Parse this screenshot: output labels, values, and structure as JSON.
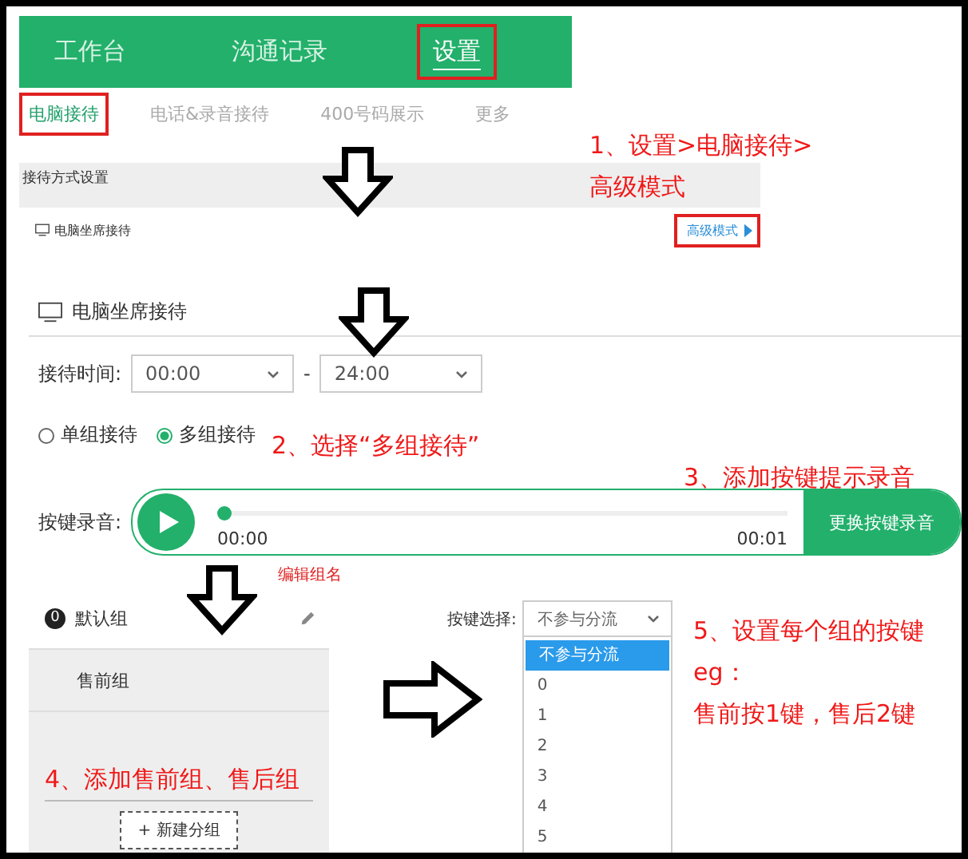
{
  "top_nav": {
    "tabs": [
      {
        "label": "工作台",
        "selected": false,
        "highlighted": false
      },
      {
        "label": "沟通记录",
        "selected": false,
        "highlighted": false
      },
      {
        "label": "设置",
        "selected": true,
        "highlighted": true
      }
    ]
  },
  "sub_tabs": [
    {
      "label": "电脑接待",
      "selected": true,
      "highlighted": true
    },
    {
      "label": "电话&录音接待",
      "selected": false,
      "highlighted": false
    },
    {
      "label": "400号码展示",
      "selected": false,
      "highlighted": false
    },
    {
      "label": "更多",
      "selected": false,
      "highlighted": false
    }
  ],
  "section": {
    "title": "接待方式设置",
    "row_label": "电脑坐席接待",
    "link": "高级模式",
    "link_highlighted": true
  },
  "panel": {
    "title": "电脑坐席接待",
    "time_label": "接待时间:",
    "start": "00:00",
    "separator": "-",
    "end": "24:00",
    "modes": [
      {
        "label": "单组接待",
        "selected": false
      },
      {
        "label": "多组接待",
        "selected": true
      }
    ],
    "recording_label": "按键录音:",
    "player": {
      "level": 0,
      "elapsed": "00:00",
      "total": "00:01",
      "button": "更换按键录音"
    }
  },
  "groups": [
    {
      "badge": "0",
      "name": "默认组",
      "selected": true
    },
    {
      "name": "售前组",
      "selected": false
    }
  ],
  "edit_hint": "编辑组名",
  "new_group_button": "+ 新建分组",
  "key_select": {
    "label": "按键选择:",
    "value": "不参与分流",
    "options": [
      {
        "label": "不参与分流",
        "selected": true
      },
      {
        "label": "0",
        "selected": false
      },
      {
        "label": "1",
        "selected": false
      },
      {
        "label": "2",
        "selected": false
      },
      {
        "label": "3",
        "selected": false
      },
      {
        "label": "4",
        "selected": false
      },
      {
        "label": "5",
        "selected": false
      }
    ]
  },
  "annotations": [
    {
      "lines": [
        "1、设置>电脑接待>",
        "高级模式"
      ]
    },
    {
      "lines": [
        "2、选择“多组接待”"
      ]
    },
    {
      "lines": [
        "3、添加按键提示录音"
      ]
    },
    {
      "lines": [
        "4、添加售前组、售后组"
      ]
    },
    {
      "lines": [
        "5、设置每个组的按键",
        "eg：",
        "售前按1键，售后2键"
      ]
    }
  ]
}
